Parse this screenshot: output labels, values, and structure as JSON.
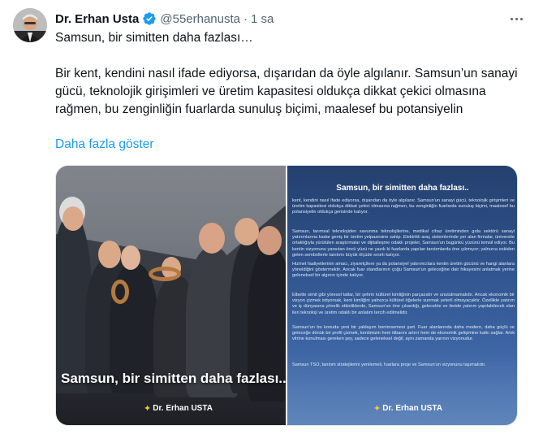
{
  "author": {
    "display_name": "Dr. Erhan Usta",
    "handle": "@55erhanusta",
    "separator": "·",
    "timestamp": "1 sa",
    "verified_icon": "verified-badge-icon",
    "avatar_icon": "avatar"
  },
  "tweet": {
    "first_line": "Samsun, bir simitten daha fazlası…",
    "body": "Bir kent, kendini nasıl ifade ediyorsa, dışarıdan da öyle algılanır. Samsun’un sanayi gücü, teknolojik girişimleri ve üretim kapasitesi oldukça dikkat çekici olmasına rağmen, bu zenginliğin fuarlarda sunuluş biçimi, maalesef bu potansiyelin",
    "show_more": "Daha fazla göster"
  },
  "media": {
    "left_caption": "Samsun, bir simitten daha fazlası..",
    "brand_left": "Dr. Erhan USTA",
    "right_title": "Samsun, bir simitten daha fazlası..",
    "right_paragraphs": [
      "kent, kendini nasıl ifade ediyorsa, dışarıdan da öyle algılanır. Samsun'un sanayi gücü, teknolojik girişimleri ve üretim kapasitesi oldukça dikkat çekici olmasına rağmen, bu zenginliğin fuarlarda sunuluş biçimi, maalesef bu potansiyelin oldukça gerisinde kalıyor.",
      "Samsun, tarımsal teknolojiden savunma teknolojilerine, medikal cihaz üretiminden gıda sektörü sanayi yatırımlarına kadar geniş bir üretim yelpazesine sahip. Elektrikli araç sistemlerinde yer alan firmalar, üniversite ortaklığıyla yürütülen araştırmalar ve dijitalleşme odaklı projeler, Samsun'un bugünkü yüzünü temsil ediyor. Bu kentin vizyonunu yansıtan öncü yüzü ne yazık ki fuarlarda yapılan tanıtımlarda öne çıkmıyor; yalnızca eskiden gelen sembollerle tanıtımı büyük ölçüde sınırlı kalıyor.",
      "Hizmet faaliyetlerinin amacı, ziyaretçilere ya da potansiyel yatırımcılara kentin üretim gücünü ve hangi alanlara yöneldiğini göstermektir. Ancak fuar standlarının çoğu Samsun'un geleceğine dair hikayesini anlatmak yerine geleneksel bir algının içinde kalıyor.",
      "Elbette simit gibi yöresel tatlar, bir şehrin kültürel kimliğinin parçasıdır ve unutulmamalıdır. Ancak ekonomik bir vizyon çizmek istiyorsak, kent kimliğini yalnızca kültürel öğelerle sunmak yeterli olmayacaktır. Özellikle yatırım ve iş dünyasına yönelik etkinliklerde, Samsun'un öne çıkardığı, gelecekte ve ileride yatırım yapılabilecek olan ileri teknoloji ve üretim odaklı bir anlatım tercih edilmelidir.",
      "Samsun'un bu konuda yeni bir yaklaşım benimsemesi şart. Fuar alanlarında daha modern, daha güçlü ve geleceğe dönük bir profil çizmek, kentimizin hem itibarını artırır hem de ekonomik gelişimine katkı sağlar. Artık vitrine konulması gereken şey, sadece geleneksel değil, aynı zamanda yarının vizyonudur.",
      "Samsun TSO, tanıtım stratejilerini yenilemeli, fuarlara proje ve Samsun'un vizyonunu taşımalıdır."
    ],
    "brand_right": "Dr. Erhan USTA"
  },
  "icons": {
    "more": "more-options-icon",
    "brand_star": "star-icon"
  },
  "colors": {
    "link": "#1d9bf0",
    "secondary_text": "#536471",
    "primary_text": "#0f1419",
    "verified": "#1d9bf0"
  }
}
